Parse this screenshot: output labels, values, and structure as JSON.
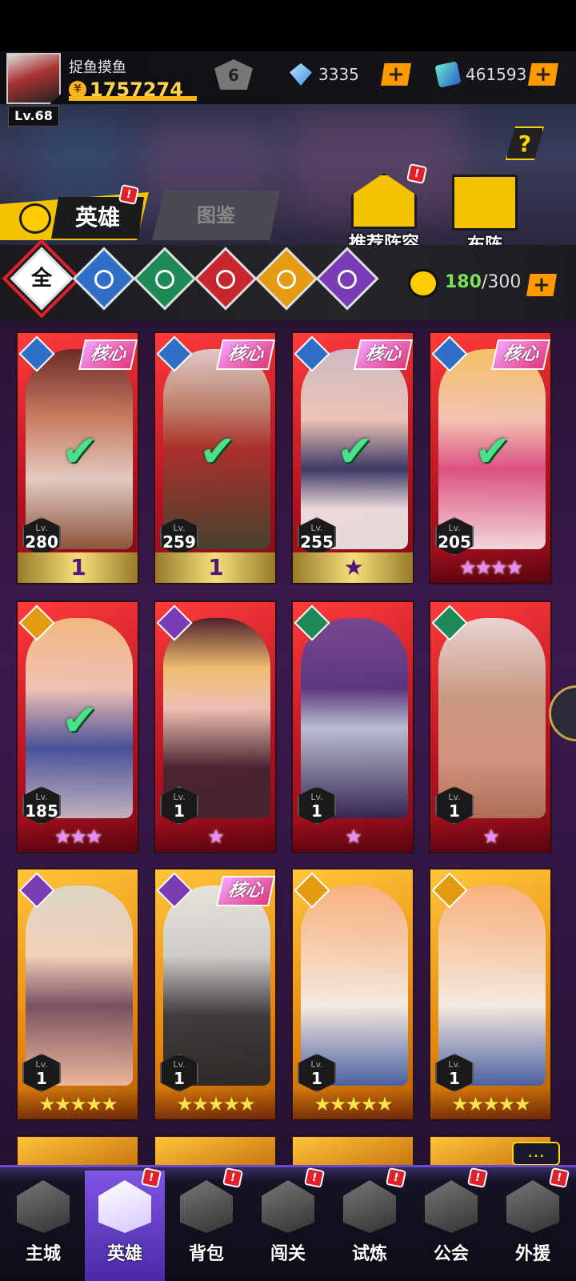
{
  "player": {
    "name": "捉鱼摸鱼",
    "level": "Lv.68",
    "gold": "1757274",
    "vip": "6"
  },
  "resources": [
    {
      "icon": "diamond-icon",
      "value": "3335"
    },
    {
      "icon": "ticket-icon",
      "value": "461593"
    }
  ],
  "plus_label": "+",
  "help_label": "?",
  "tabs": {
    "hero": "英雄",
    "atlas": "图鉴"
  },
  "actions": {
    "recommend": "推荐阵容",
    "formation": "布阵"
  },
  "badge": "!",
  "filters": {
    "all": "全"
  },
  "capacity": {
    "current": "180",
    "max": "/300"
  },
  "core_label": "核心",
  "lv_prefix": "Lv.",
  "heroes": [
    {
      "element": "water",
      "core": true,
      "checked": true,
      "level": "280",
      "rank": "1",
      "stars": ""
    },
    {
      "element": "water",
      "core": true,
      "checked": true,
      "level": "259",
      "rank": "1",
      "stars": ""
    },
    {
      "element": "water",
      "core": true,
      "checked": true,
      "level": "255",
      "rank": "★",
      "stars": ""
    },
    {
      "element": "water",
      "core": true,
      "checked": true,
      "level": "205",
      "rank": "",
      "stars": "★★★★"
    },
    {
      "element": "light",
      "core": false,
      "checked": true,
      "level": "185",
      "rank": "",
      "stars": "★★★"
    },
    {
      "element": "dark",
      "core": false,
      "checked": false,
      "level": "1",
      "rank": "",
      "stars": "★"
    },
    {
      "element": "wind",
      "core": false,
      "checked": false,
      "level": "1",
      "rank": "",
      "stars": "★"
    },
    {
      "element": "wind",
      "core": false,
      "checked": false,
      "level": "1",
      "rank": "",
      "stars": "★"
    },
    {
      "element": "dark",
      "core": false,
      "checked": false,
      "level": "1",
      "rank": "",
      "stars": "★★★★★"
    },
    {
      "element": "dark",
      "core": true,
      "checked": false,
      "level": "1",
      "rank": "",
      "stars": "★★★★★"
    },
    {
      "element": "light",
      "core": false,
      "checked": false,
      "level": "1",
      "rank": "",
      "stars": "★★★★★"
    },
    {
      "element": "light",
      "core": false,
      "checked": false,
      "level": "1",
      "rank": "",
      "stars": "★★★★★"
    }
  ],
  "nav": [
    {
      "label": "主城"
    },
    {
      "label": "英雄"
    },
    {
      "label": "背包"
    },
    {
      "label": "闯关"
    },
    {
      "label": "试炼"
    },
    {
      "label": "公会"
    },
    {
      "label": "外援"
    }
  ],
  "chat_icon": "…"
}
